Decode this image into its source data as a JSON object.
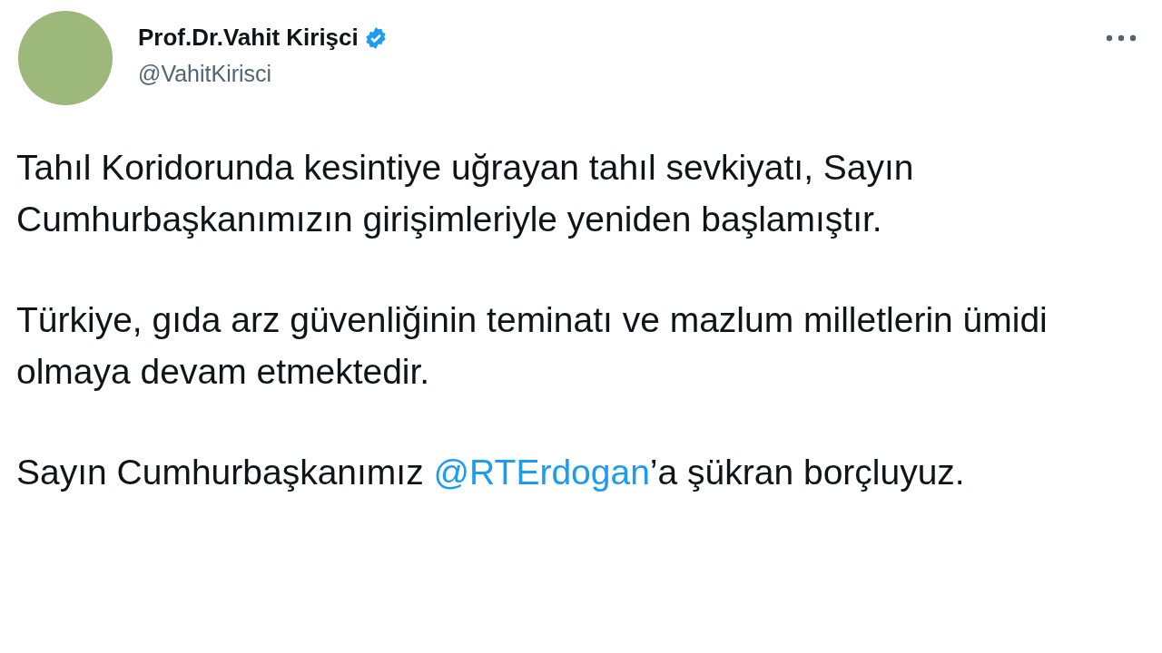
{
  "author": {
    "name": "Prof.Dr.Vahit Kirişci",
    "verified": true,
    "handle": "@VahitKirisci"
  },
  "paragraphs": [
    [
      {
        "kind": "text",
        "text": "Tahıl Koridorunda kesintiye uğrayan tahıl sevkiyatı, Sayın Cumhurbaşkanımızın girişimleriyle yeniden başlamıştır."
      }
    ],
    [
      {
        "kind": "text",
        "text": "Türkiye, gıda arz güvenliğinin teminatı ve mazlum milletlerin ümidi olmaya devam etmektedir."
      }
    ],
    [
      {
        "kind": "text",
        "text": "Sayın Cumhurbaşkanımız "
      },
      {
        "kind": "mention",
        "text": "@RTErdogan"
      },
      {
        "kind": "text",
        "text": "’a şükran borçluyuz."
      }
    ]
  ]
}
